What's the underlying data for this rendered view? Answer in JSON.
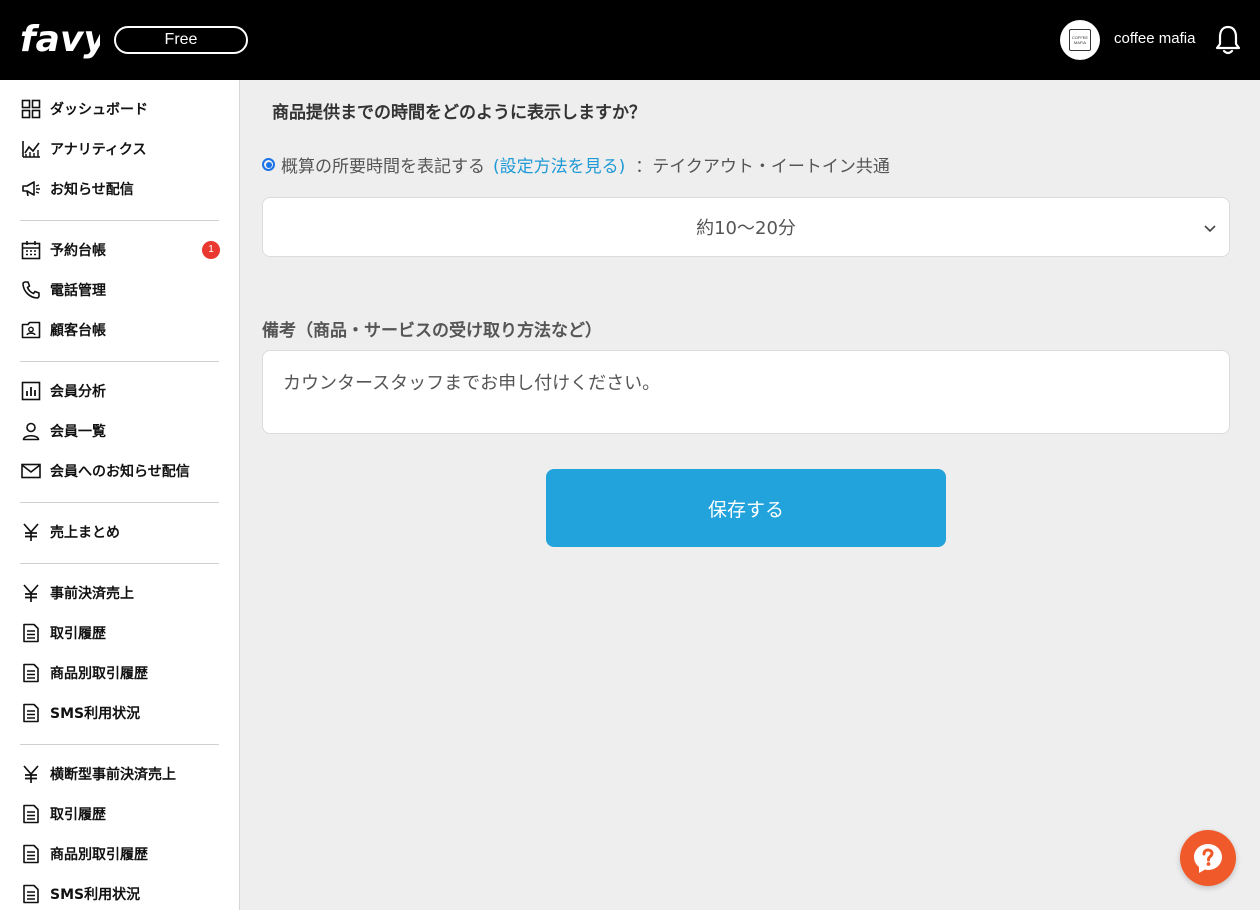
{
  "header": {
    "logo_text": "favy",
    "plan": "Free",
    "account_name": "coffee mafia",
    "avatar_text": [
      "COFFEE",
      "MAFIA"
    ]
  },
  "sidebar": {
    "items": [
      {
        "label": "ダッシュボード",
        "icon": "dashboard-grid-icon"
      },
      {
        "label": "アナリティクス",
        "icon": "analytics-chart-icon"
      },
      {
        "label": "お知らせ配信",
        "icon": "megaphone-icon"
      },
      {
        "label": "予約台帳",
        "icon": "calendar-icon",
        "badge": "1"
      },
      {
        "label": "電話管理",
        "icon": "phone-icon"
      },
      {
        "label": "顧客台帳",
        "icon": "contact-card-icon"
      },
      {
        "label": "会員分析",
        "icon": "bar-chart-icon"
      },
      {
        "label": "会員一覧",
        "icon": "person-icon"
      },
      {
        "label": "会員へのお知らせ配信",
        "icon": "mail-icon"
      },
      {
        "label": "売上まとめ",
        "icon": "yen-icon"
      },
      {
        "label": "事前決済売上",
        "icon": "yen-icon"
      },
      {
        "label": "取引履歴",
        "icon": "document-icon"
      },
      {
        "label": "商品別取引履歴",
        "icon": "document-icon"
      },
      {
        "label": "SMS利用状況",
        "icon": "document-icon"
      },
      {
        "label": "横断型事前決済売上",
        "icon": "yen-icon"
      },
      {
        "label": "取引履歴",
        "icon": "document-icon"
      },
      {
        "label": "商品別取引履歴",
        "icon": "document-icon"
      },
      {
        "label": "SMS利用状況",
        "icon": "document-icon"
      }
    ]
  },
  "main": {
    "section_title": "商品提供までの時間をどのように表示しますか？",
    "radio_label": "概算の所要時間を表記する",
    "radio_link": "(設定方法を見る)",
    "radio_note": "：テイクアウト・イートイン共通",
    "select_value": "約10〜20分",
    "notes_label": "備考（商品・サービスの受け取り方法など）",
    "notes_value": "カウンタースタッフまでお申し付けください。",
    "save_label": "保存する"
  },
  "colors": {
    "header_bg": "#000000",
    "accent": "#22a3dc",
    "link": "#1f9ad6",
    "badge": "#e8382f",
    "help_fab": "#f05a2a"
  }
}
